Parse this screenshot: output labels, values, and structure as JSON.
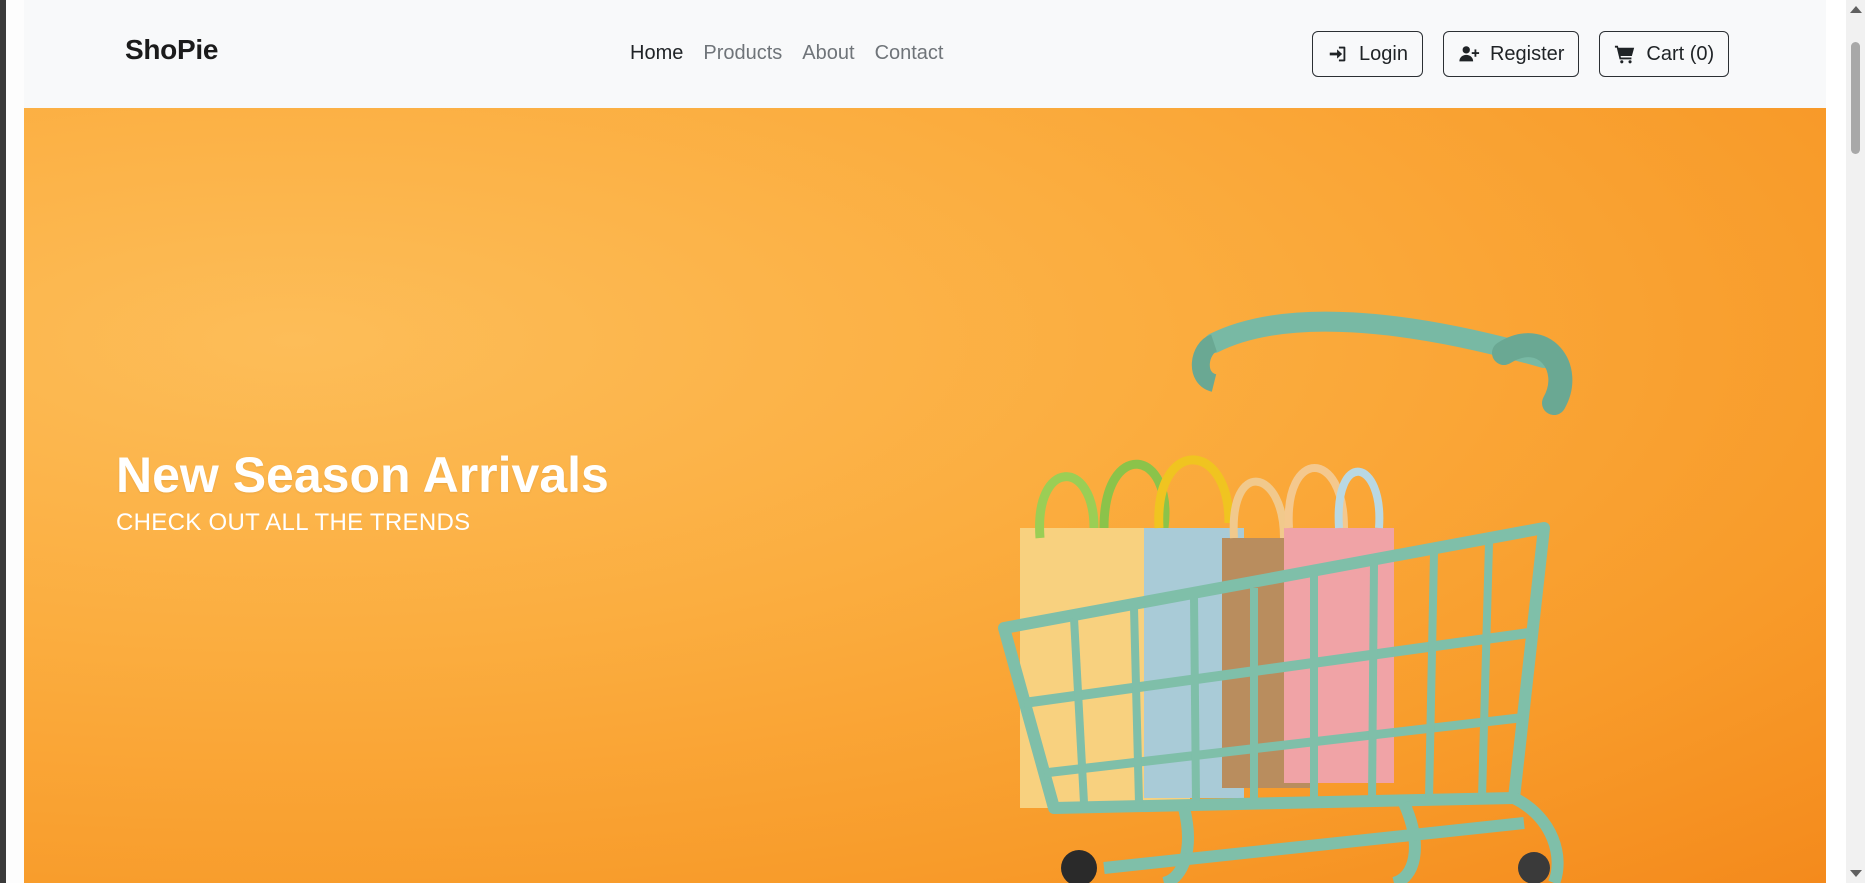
{
  "navbar": {
    "brand": "ShoPie",
    "links": [
      {
        "label": "Home",
        "active": true
      },
      {
        "label": "Products",
        "active": false
      },
      {
        "label": "About",
        "active": false
      },
      {
        "label": "Contact",
        "active": false
      }
    ],
    "buttons": {
      "login": {
        "label": "Login",
        "icon": "sign-in-icon"
      },
      "register": {
        "label": "Register",
        "icon": "user-plus-icon"
      },
      "cart": {
        "label": "Cart (0)",
        "icon": "shopping-cart-icon"
      }
    }
  },
  "hero": {
    "title": "New Season Arrivals",
    "subtitle": "CHECK OUT ALL THE TRENDS",
    "image": "shopping-cart-with-bags-illustration",
    "colors": {
      "background": "#fbad3f",
      "cart": "#7fbfa9"
    }
  }
}
